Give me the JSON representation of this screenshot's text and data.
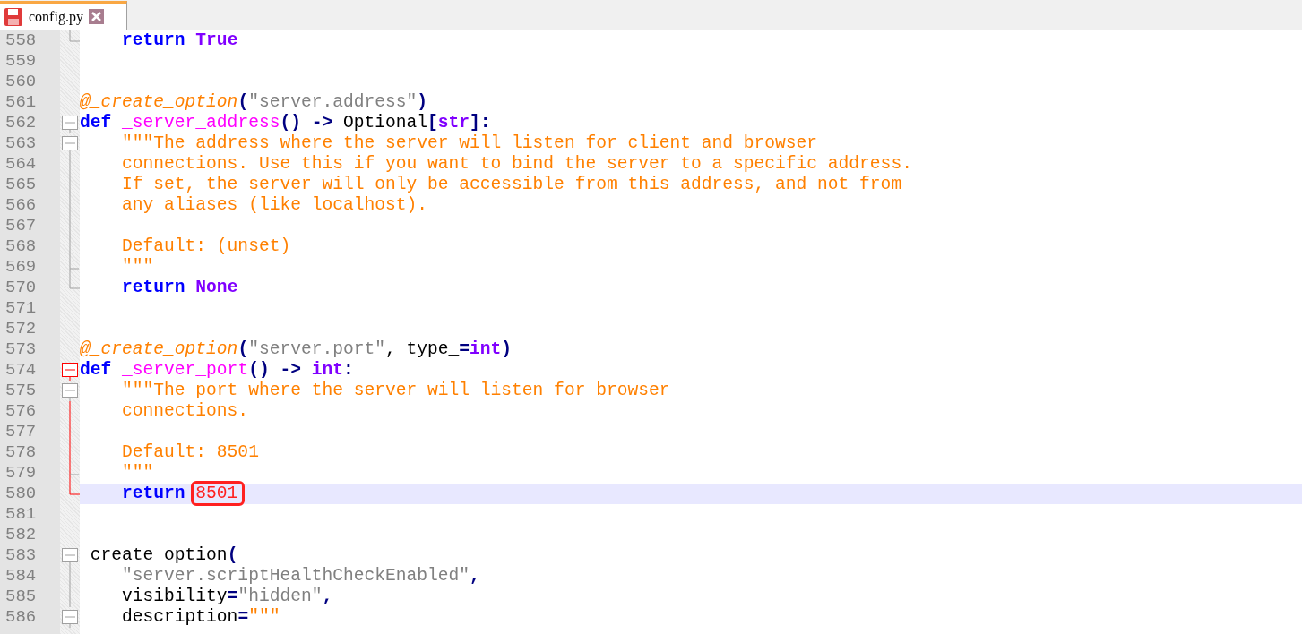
{
  "tabs": [
    {
      "label": "config.py",
      "selected": true,
      "modified": true
    }
  ],
  "lines": [
    {
      "number": "558",
      "fold": {
        "kind": "end",
        "active": false
      },
      "current": false,
      "tokens": [
        {
          "kind": "kw",
          "t": "    return"
        },
        {
          "kind": "builtin",
          "t": " True"
        }
      ]
    },
    {
      "number": "559",
      "current": false
    },
    {
      "number": "560",
      "current": false
    },
    {
      "number": "561",
      "current": false,
      "tokens": [
        {
          "kind": "deco",
          "t": "@_create_option"
        },
        {
          "kind": "op",
          "t": "("
        },
        {
          "kind": "string",
          "t": "\"server.address\""
        },
        {
          "kind": "op",
          "t": ")"
        }
      ]
    },
    {
      "number": "562",
      "fold": {
        "kind": "box",
        "active": false
      },
      "current": false,
      "tokens": [
        {
          "kind": "kw",
          "t": "def"
        },
        {
          "kind": "fname",
          "t": " _server_address"
        },
        {
          "kind": "op",
          "t": "()"
        },
        {
          "kind": "op",
          "t": " ->"
        },
        {
          "kind": "plain",
          "t": " Optional"
        },
        {
          "kind": "op",
          "t": "["
        },
        {
          "kind": "builtin",
          "t": "str"
        },
        {
          "kind": "op",
          "t": "]:"
        }
      ]
    },
    {
      "number": "563",
      "fold": {
        "kind": "box",
        "active": false
      },
      "current": false,
      "tokens": [
        {
          "kind": "doc",
          "t": "    \"\"\"The address where the server will listen for client and browser"
        }
      ]
    },
    {
      "number": "564",
      "fold": {
        "kind": "line",
        "active": false
      },
      "current": false,
      "tokens": [
        {
          "kind": "doc",
          "t": "    connections. Use this if you want to bind the server to a specific address."
        }
      ]
    },
    {
      "number": "565",
      "fold": {
        "kind": "line",
        "active": false
      },
      "current": false,
      "tokens": [
        {
          "kind": "doc",
          "t": "    If set, the server will only be accessible from this address, and not from"
        }
      ]
    },
    {
      "number": "566",
      "fold": {
        "kind": "line",
        "active": false
      },
      "current": false,
      "tokens": [
        {
          "kind": "doc",
          "t": "    any aliases (like localhost)."
        }
      ]
    },
    {
      "number": "567",
      "fold": {
        "kind": "line",
        "active": false
      },
      "current": false
    },
    {
      "number": "568",
      "fold": {
        "kind": "line",
        "active": false
      },
      "current": false,
      "tokens": [
        {
          "kind": "doc",
          "t": "    Default: (unset)"
        }
      ]
    },
    {
      "number": "569",
      "fold": {
        "kind": "tee",
        "active": false
      },
      "current": false,
      "tokens": [
        {
          "kind": "doc",
          "t": "    \"\"\""
        }
      ]
    },
    {
      "number": "570",
      "fold": {
        "kind": "end",
        "active": false
      },
      "current": false,
      "tokens": [
        {
          "kind": "kw",
          "t": "    return"
        },
        {
          "kind": "builtin",
          "t": " None"
        }
      ]
    },
    {
      "number": "571",
      "current": false
    },
    {
      "number": "572",
      "current": false
    },
    {
      "number": "573",
      "current": false,
      "tokens": [
        {
          "kind": "deco",
          "t": "@_create_option"
        },
        {
          "kind": "op",
          "t": "("
        },
        {
          "kind": "string",
          "t": "\"server.port\""
        },
        {
          "kind": "plain",
          "t": ", type_"
        },
        {
          "kind": "op",
          "t": "="
        },
        {
          "kind": "builtin",
          "t": "int"
        },
        {
          "kind": "op",
          "t": ")"
        }
      ]
    },
    {
      "number": "574",
      "fold": {
        "kind": "box",
        "active": true
      },
      "current": false,
      "tokens": [
        {
          "kind": "kw",
          "t": "def"
        },
        {
          "kind": "fname",
          "t": " _server_port"
        },
        {
          "kind": "op",
          "t": "()"
        },
        {
          "kind": "op",
          "t": " ->"
        },
        {
          "kind": "builtin",
          "t": " int"
        },
        {
          "kind": "op",
          "t": ":"
        }
      ]
    },
    {
      "number": "575",
      "fold": {
        "kind": "box",
        "active": false
      },
      "current": false,
      "tokens": [
        {
          "kind": "doc",
          "t": "    \"\"\"The port where the server will listen for browser"
        }
      ]
    },
    {
      "number": "576",
      "fold": {
        "kind": "line",
        "active": true
      },
      "current": false,
      "tokens": [
        {
          "kind": "doc",
          "t": "    connections."
        }
      ]
    },
    {
      "number": "577",
      "fold": {
        "kind": "line",
        "active": true
      },
      "current": false
    },
    {
      "number": "578",
      "fold": {
        "kind": "line",
        "active": true
      },
      "current": false,
      "tokens": [
        {
          "kind": "doc",
          "t": "    Default: 8501"
        }
      ]
    },
    {
      "number": "579",
      "fold": {
        "kind": "tee",
        "active": true
      },
      "current": false,
      "tokens": [
        {
          "kind": "doc",
          "t": "    \"\"\""
        }
      ]
    },
    {
      "number": "580",
      "fold": {
        "kind": "end",
        "active": true
      },
      "current": true,
      "tokens": [
        {
          "kind": "kw",
          "t": "    return "
        },
        {
          "kind": "number",
          "t": "8501",
          "boxed": true
        }
      ]
    },
    {
      "number": "581",
      "current": false
    },
    {
      "number": "582",
      "current": false
    },
    {
      "number": "583",
      "fold": {
        "kind": "box",
        "active": false
      },
      "current": false,
      "tokens": [
        {
          "kind": "plain",
          "t": "_create_option"
        },
        {
          "kind": "op",
          "t": "("
        }
      ]
    },
    {
      "number": "584",
      "fold": {
        "kind": "line",
        "active": false
      },
      "current": false,
      "tokens": [
        {
          "kind": "string",
          "t": "    \"server.scriptHealthCheckEnabled\""
        },
        {
          "kind": "op",
          "t": ","
        }
      ]
    },
    {
      "number": "585",
      "fold": {
        "kind": "line",
        "active": false
      },
      "current": false,
      "tokens": [
        {
          "kind": "plain",
          "t": "    visibility"
        },
        {
          "kind": "op",
          "t": "="
        },
        {
          "kind": "string",
          "t": "\"hidden\""
        },
        {
          "kind": "op",
          "t": ","
        }
      ]
    },
    {
      "number": "586",
      "fold": {
        "kind": "box",
        "active": false
      },
      "current": false,
      "tokens": [
        {
          "kind": "plain",
          "t": "    description"
        },
        {
          "kind": "op",
          "t": "="
        },
        {
          "kind": "doc",
          "t": "\"\"\""
        }
      ]
    }
  ]
}
